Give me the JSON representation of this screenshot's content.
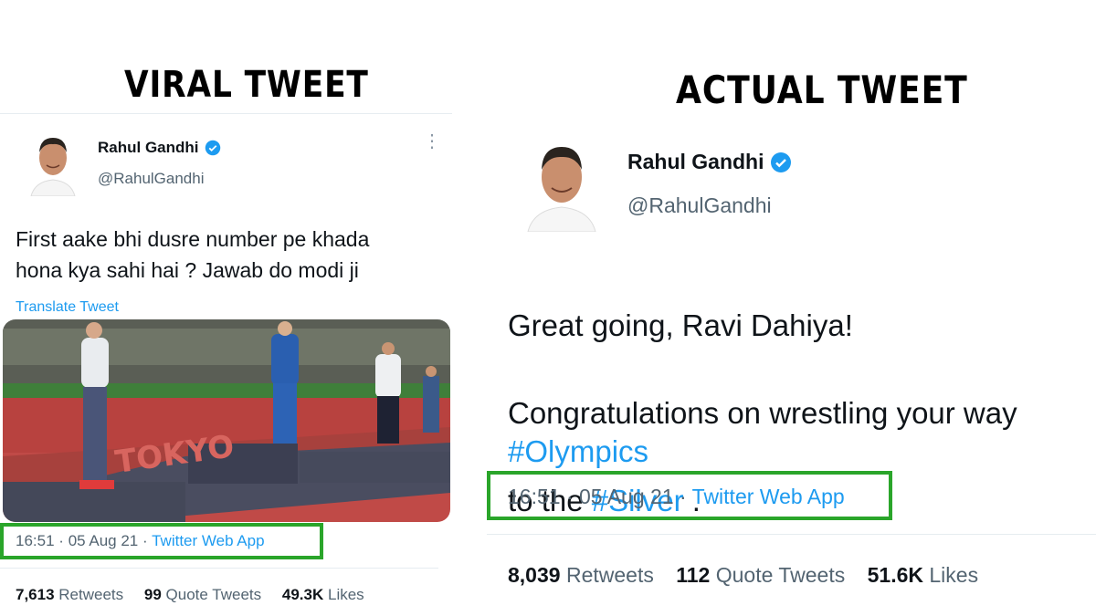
{
  "left": {
    "heading": "VIRAL TWEET",
    "name": "Rahul Gandhi",
    "handle": "@RahulGandhi",
    "text": "First aake bhi dusre number pe khada\nhona kya sahi hai ? Jawab do modi ji",
    "translate": "Translate Tweet",
    "time": "16:51",
    "date": "05 Aug 21",
    "source": "Twitter Web App",
    "sep": "·",
    "stats": [
      {
        "count": "7,613",
        "label": "Retweets"
      },
      {
        "count": "99",
        "label": "Quote Tweets"
      },
      {
        "count": "49.3K",
        "label": "Likes"
      }
    ],
    "photo_banner": "TOKYO"
  },
  "right": {
    "heading": "ACTUAL TWEET",
    "name": "Rahul Gandhi",
    "handle": "@RahulGandhi",
    "line1": "Great going, Ravi Dahiya!",
    "line2": "Congratulations on wrestling your way",
    "line3_pre": "to the ",
    "line3_tag": "#Silver",
    "line3_post": " .",
    "tag2": "#Olympics",
    "time": "16:51",
    "date": "05 Aug 21",
    "source": "Twitter Web App",
    "sep": "·",
    "stats": [
      {
        "count": "8,039",
        "label": "Retweets"
      },
      {
        "count": "112",
        "label": "Quote Tweets"
      },
      {
        "count": "51.6K",
        "label": "Likes"
      }
    ]
  },
  "colors": {
    "accent": "#1d9bf0",
    "highlight_box": "#2aa52a",
    "muted": "#536471"
  }
}
